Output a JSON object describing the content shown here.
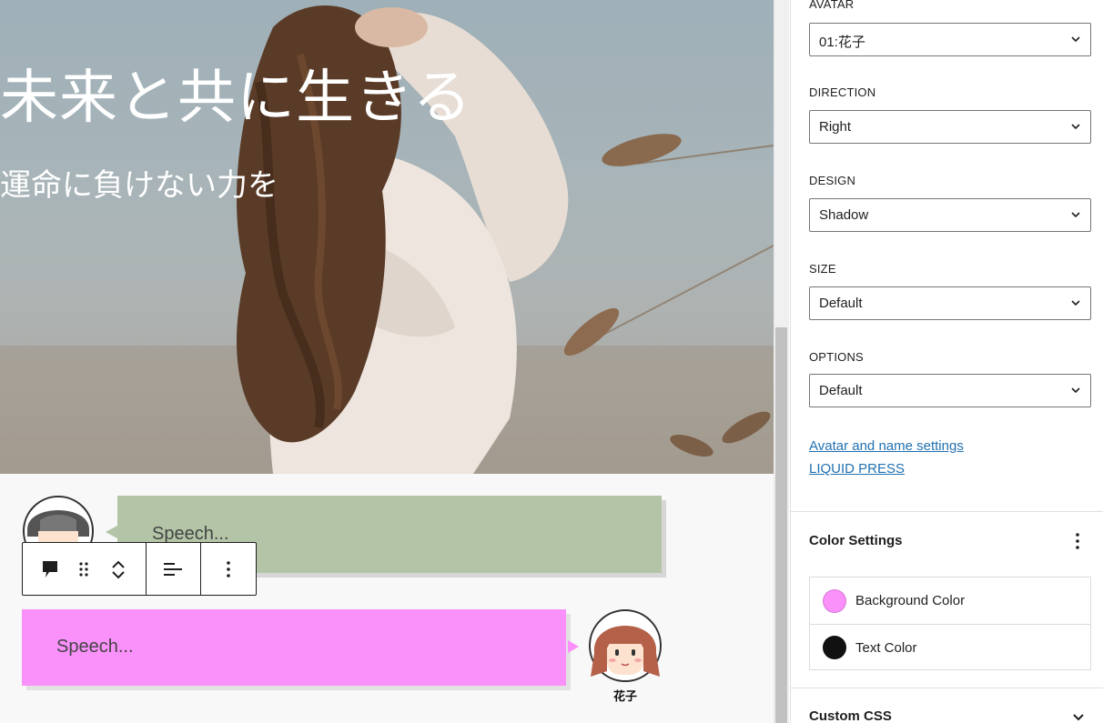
{
  "hero": {
    "title": "未来と共に生きる",
    "subtitle": "運命に負けない力を"
  },
  "speech_blocks": [
    {
      "text": "Speech...",
      "bg_color": "#b3c5a6",
      "avatar_side": "left"
    },
    {
      "text": "Speech...",
      "bg_color": "#fa90fa",
      "avatar_side": "right",
      "avatar_name": "花子"
    }
  ],
  "block_toolbar": {
    "icons": [
      "speech-bubble-icon",
      "drag-handle-icon",
      "move-up-icon",
      "move-down-icon",
      "align-left-icon",
      "more-options-icon"
    ]
  },
  "sidebar": {
    "fields": [
      {
        "label": "AVATAR",
        "value": "01:花子"
      },
      {
        "label": "DIRECTION",
        "value": "Right"
      },
      {
        "label": "DESIGN",
        "value": "Shadow"
      },
      {
        "label": "SIZE",
        "value": "Default"
      },
      {
        "label": "OPTIONS",
        "value": "Default"
      }
    ],
    "links": [
      "Avatar and name settings",
      "LIQUID PRESS"
    ],
    "color_settings": {
      "title": "Color Settings",
      "items": [
        {
          "label": "Background Color",
          "color": "#fa90fa"
        },
        {
          "label": "Text Color",
          "color": "#111111"
        }
      ]
    },
    "custom_css": {
      "title": "Custom CSS"
    }
  },
  "colors": {
    "link": "#2271b1",
    "border": "#757575"
  }
}
